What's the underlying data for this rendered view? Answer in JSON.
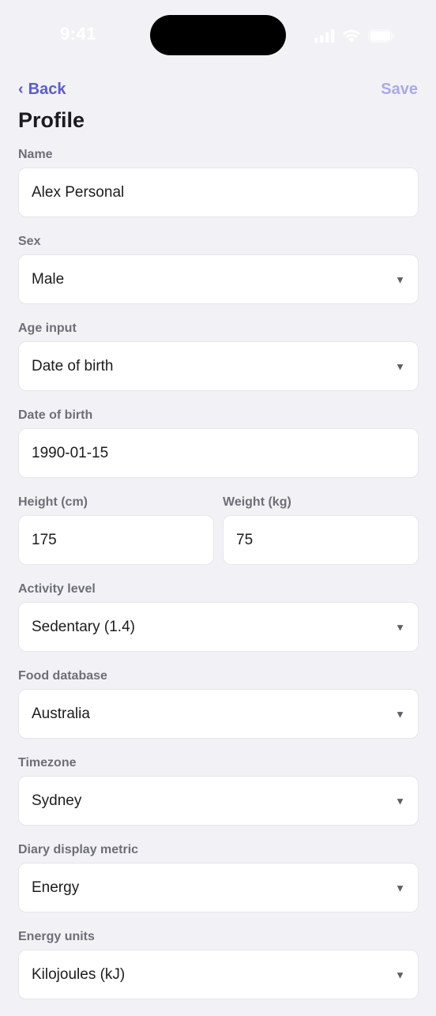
{
  "status_bar": {
    "time": "9:41"
  },
  "nav": {
    "back_label": "Back",
    "back_chevron": "‹",
    "save_label": "Save"
  },
  "page": {
    "title": "Profile"
  },
  "form": {
    "name": {
      "label": "Name",
      "value": "Alex Personal"
    },
    "sex": {
      "label": "Sex",
      "value": "Male"
    },
    "age_input": {
      "label": "Age input",
      "value": "Date of birth"
    },
    "dob": {
      "label": "Date of birth",
      "value": "1990-01-15"
    },
    "height": {
      "label": "Height (cm)",
      "value": "175"
    },
    "weight": {
      "label": "Weight (kg)",
      "value": "75"
    },
    "activity": {
      "label": "Activity level",
      "value": "Sedentary (1.4)"
    },
    "food_db": {
      "label": "Food database",
      "value": "Australia"
    },
    "timezone": {
      "label": "Timezone",
      "value": "Sydney"
    },
    "diary_metric": {
      "label": "Diary display metric",
      "value": "Energy"
    },
    "energy_units": {
      "label": "Energy units",
      "value": "Kilojoules (kJ)"
    }
  },
  "icons": {
    "caret": "▼",
    "signal": "signal-icon",
    "wifi": "wifi-icon",
    "battery": "battery-icon"
  },
  "colors": {
    "accent": "#5b5bd6",
    "accent_disabled": "#a9a9ea",
    "background": "#f2f2f6",
    "label": "#6e6e78"
  }
}
